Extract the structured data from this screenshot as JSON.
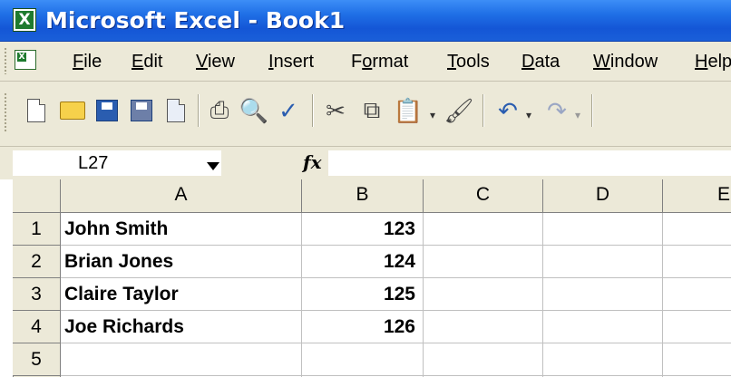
{
  "window": {
    "title": "Microsoft Excel - Book1",
    "app_icon_letter": "X"
  },
  "menu": [
    {
      "label_pre": "",
      "label_ul": "F",
      "label_post": "ile"
    },
    {
      "label_pre": "",
      "label_ul": "E",
      "label_post": "dit"
    },
    {
      "label_pre": "",
      "label_ul": "V",
      "label_post": "iew"
    },
    {
      "label_pre": "",
      "label_ul": "I",
      "label_post": "nsert"
    },
    {
      "label_pre": "F",
      "label_ul": "o",
      "label_post": "rmat"
    },
    {
      "label_pre": "",
      "label_ul": "T",
      "label_post": "ools"
    },
    {
      "label_pre": "",
      "label_ul": "D",
      "label_post": "ata"
    },
    {
      "label_pre": "",
      "label_ul": "W",
      "label_post": "indow"
    },
    {
      "label_pre": "",
      "label_ul": "H",
      "label_post": "elp"
    }
  ],
  "toolbar": {
    "icons": [
      "new-icon",
      "open-icon",
      "save-icon",
      "permission-icon",
      "research-icon",
      "print-icon",
      "print-preview-icon",
      "spelling-icon",
      "cut-icon",
      "copy-icon",
      "paste-icon",
      "format-painter-icon",
      "undo-icon",
      "redo-icon"
    ],
    "glyphs": {
      "print": "⎙",
      "preview": "🔍",
      "spelling": "✓",
      "cut": "✂",
      "copy": "⧉",
      "paste": "📋",
      "painter": "🖌",
      "undo": "↶",
      "redo": "↷",
      "dropdown": "▾"
    }
  },
  "formula_bar": {
    "name_box": "L27",
    "fx_label": "fx",
    "formula": ""
  },
  "sheet": {
    "columns": [
      "A",
      "B",
      "C",
      "D",
      "E"
    ],
    "rows": [
      "1",
      "2",
      "3",
      "4",
      "5"
    ],
    "cells": [
      {
        "a": "John Smith",
        "b": "123"
      },
      {
        "a": "Brian Jones",
        "b": "124"
      },
      {
        "a": "Claire Taylor",
        "b": "125"
      },
      {
        "a": "Joe Richards",
        "b": "126"
      },
      {
        "a": "",
        "b": ""
      }
    ]
  },
  "colors": {
    "titlebar": "#1f6fe6",
    "chrome": "#ece9d8",
    "excel_green": "#1e7a2e",
    "gridline": "#c0c0c0",
    "header_border": "#808080"
  }
}
